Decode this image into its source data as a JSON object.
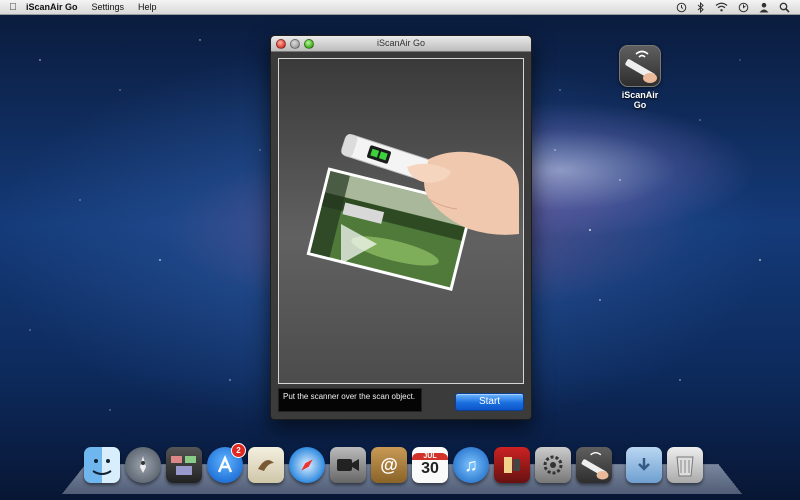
{
  "menubar": {
    "app_name": "iScanAir Go",
    "items": [
      "Settings",
      "Help"
    ]
  },
  "desktop_icon": {
    "label": "iScanAir Go"
  },
  "window": {
    "title": "iScanAir Go",
    "status_text": "Put the scanner over the scan object.",
    "start_label": "Start"
  },
  "dock": {
    "items": [
      {
        "name": "finder-icon"
      },
      {
        "name": "launchpad-icon"
      },
      {
        "name": "mission-control-icon"
      },
      {
        "name": "app-store-icon",
        "badge": "2"
      },
      {
        "name": "mail-icon"
      },
      {
        "name": "safari-icon"
      },
      {
        "name": "facetime-icon"
      },
      {
        "name": "address-book-icon"
      },
      {
        "name": "calendar-icon",
        "date": "30",
        "month": "JUL"
      },
      {
        "name": "itunes-icon"
      },
      {
        "name": "photo-booth-icon"
      },
      {
        "name": "system-preferences-icon"
      },
      {
        "name": "iscanair-go-icon"
      },
      {
        "name": "downloads-folder-icon"
      },
      {
        "name": "trash-icon"
      }
    ]
  },
  "colors": {
    "accent_button": "#1a6fe0",
    "window_bg": "#3b3b3b"
  }
}
